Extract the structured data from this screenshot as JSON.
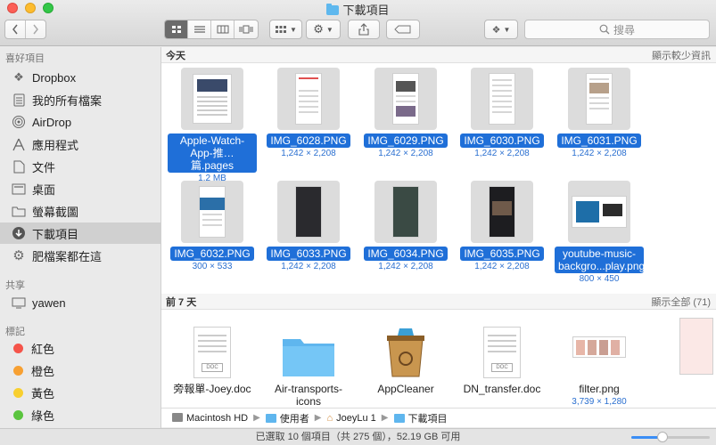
{
  "window": {
    "title": "下載項目"
  },
  "toolbar": {
    "search_placeholder": "搜尋",
    "view_buttons": [
      "icon-view",
      "list-view",
      "column-view",
      "coverflow-view"
    ],
    "active_view": "icon-view"
  },
  "sidebar": {
    "favorites_header": "喜好項目",
    "favorites": [
      {
        "label": "Dropbox",
        "icon": "dropbox-icon"
      },
      {
        "label": "我的所有檔案",
        "icon": "all-files-icon"
      },
      {
        "label": "AirDrop",
        "icon": "airdrop-icon"
      },
      {
        "label": "應用程式",
        "icon": "applications-icon"
      },
      {
        "label": "文件",
        "icon": "documents-icon"
      },
      {
        "label": "桌面",
        "icon": "desktop-icon"
      },
      {
        "label": "螢幕截圖",
        "icon": "folder-icon"
      },
      {
        "label": "下載項目",
        "icon": "downloads-icon",
        "selected": true
      },
      {
        "label": "肥檔案都在這",
        "icon": "gear-icon"
      }
    ],
    "shared_header": "共享",
    "shared": [
      {
        "label": "yawen",
        "icon": "computer-icon"
      }
    ],
    "tags_header": "標記",
    "tags": [
      {
        "label": "紅色",
        "color": "#f5544a"
      },
      {
        "label": "橙色",
        "color": "#f7a032"
      },
      {
        "label": "黃色",
        "color": "#f8cf2f"
      },
      {
        "label": "綠色",
        "color": "#5ac43e"
      }
    ]
  },
  "sections": {
    "today": {
      "title": "今天",
      "action": "顯示較少資訊"
    },
    "last7": {
      "title": "前 7 天",
      "action": "顯示全部 (71)"
    }
  },
  "today_files": [
    {
      "name": "Apple-Watch-App-推…篇.pages",
      "meta": "1.2 MB"
    },
    {
      "name": "IMG_6028.PNG",
      "meta": "1,242 × 2,208"
    },
    {
      "name": "IMG_6029.PNG",
      "meta": "1,242 × 2,208"
    },
    {
      "name": "IMG_6030.PNG",
      "meta": "1,242 × 2,208"
    },
    {
      "name": "IMG_6031.PNG",
      "meta": "1,242 × 2,208"
    },
    {
      "name": "IMG_6032.PNG",
      "meta": "300 × 533"
    },
    {
      "name": "IMG_6033.PNG",
      "meta": "1,242 × 2,208"
    },
    {
      "name": "IMG_6034.PNG",
      "meta": "1,242 × 2,208"
    },
    {
      "name": "IMG_6035.PNG",
      "meta": "1,242 × 2,208"
    },
    {
      "name": "youtube-music-backgro...play.png",
      "meta": "800 × 450"
    }
  ],
  "week_files": [
    {
      "name": "旁報單-Joey.doc",
      "meta": ""
    },
    {
      "name": "Air-transports-icons",
      "meta": ""
    },
    {
      "name": "AppCleaner",
      "meta": ""
    },
    {
      "name": "DN_transfer.doc",
      "meta": ""
    },
    {
      "name": "filter.png",
      "meta": "3,739 × 1,280"
    }
  ],
  "pathbar": [
    "Macintosh HD",
    "使用者",
    "JoeyLu 1",
    "下載項目"
  ],
  "status": {
    "text": "已選取 10 個項目（共 275 個），52.19 GB 可用",
    "zoom_level": 0.4
  }
}
